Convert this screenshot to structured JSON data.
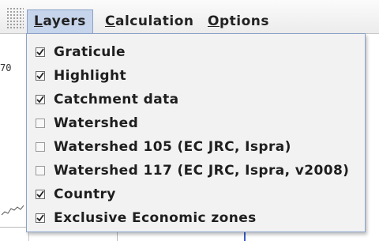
{
  "menubar": {
    "menus": [
      {
        "label": "Layers",
        "mnemonic": "L",
        "rest": "ayers"
      },
      {
        "label": "Calculation",
        "mnemonic": "C",
        "rest": "alculation"
      },
      {
        "label": "Options",
        "mnemonic": "O",
        "rest": "ptions"
      }
    ]
  },
  "map": {
    "scale_label": "70"
  },
  "layers_menu": {
    "items": [
      {
        "label": "Graticule",
        "checked": true
      },
      {
        "label": "Highlight",
        "checked": true
      },
      {
        "label": "Catchment data",
        "checked": true
      },
      {
        "label": "Watershed",
        "checked": false
      },
      {
        "label": "Watershed 105 (EC JRC, Ispra)",
        "checked": false
      },
      {
        "label": "Watershed 117 (EC JRC, Ispra, v2008)",
        "checked": false
      },
      {
        "label": "Country",
        "checked": true
      },
      {
        "label": "Exclusive Economic zones",
        "checked": true
      }
    ]
  },
  "colors": {
    "menu_highlight": "#c7d5ec",
    "menu_border": "#8aa2c9",
    "map_line": "#3a5fd0"
  }
}
